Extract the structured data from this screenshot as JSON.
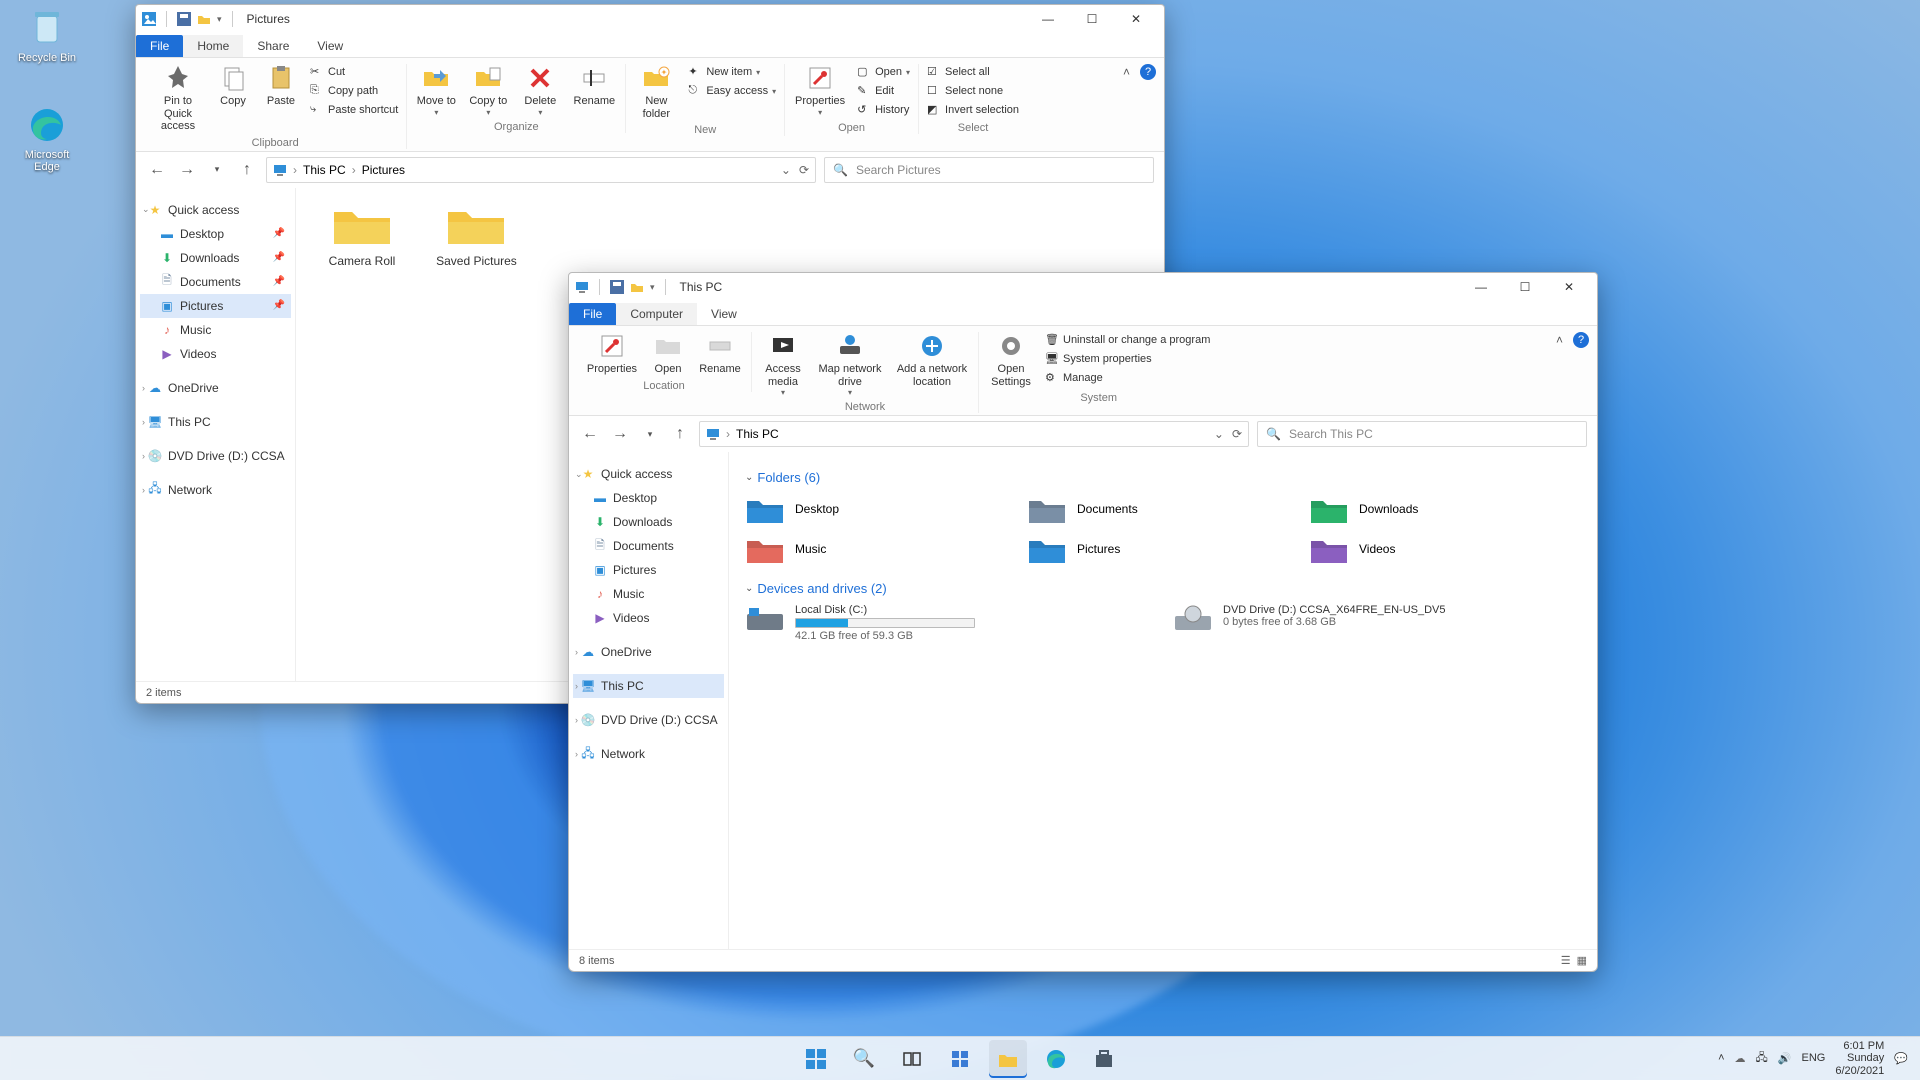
{
  "desktop": {
    "icons": [
      {
        "name": "Recycle Bin"
      },
      {
        "name": "Microsoft Edge"
      }
    ]
  },
  "win1": {
    "title": "Pictures",
    "tabs": {
      "file": "File",
      "home": "Home",
      "share": "Share",
      "view": "View"
    },
    "ribbon": {
      "clipboard": {
        "cap": "Clipboard",
        "pin": "Pin to Quick access",
        "copy": "Copy",
        "paste": "Paste",
        "cut": "Cut",
        "copypath": "Copy path",
        "pasteshort": "Paste shortcut"
      },
      "organize": {
        "cap": "Organize",
        "move": "Move to",
        "copyto": "Copy to",
        "delete": "Delete",
        "rename": "Rename"
      },
      "new": {
        "cap": "New",
        "newfolder": "New folder",
        "newitem": "New item",
        "easyaccess": "Easy access"
      },
      "open": {
        "cap": "Open",
        "properties": "Properties",
        "open": "Open",
        "edit": "Edit",
        "history": "History"
      },
      "select": {
        "cap": "Select",
        "all": "Select all",
        "none": "Select none",
        "invert": "Invert selection"
      }
    },
    "breadcrumb": {
      "pc": "This PC",
      "pictures": "Pictures"
    },
    "search_placeholder": "Search Pictures",
    "nav": {
      "quick": "Quick access",
      "desktop": "Desktop",
      "downloads": "Downloads",
      "documents": "Documents",
      "pictures": "Pictures",
      "music": "Music",
      "videos": "Videos",
      "onedrive": "OneDrive",
      "thispc": "This PC",
      "dvd": "DVD Drive (D:) CCSA",
      "network": "Network"
    },
    "items": [
      {
        "label": "Camera Roll"
      },
      {
        "label": "Saved Pictures"
      }
    ],
    "status": "2 items"
  },
  "win2": {
    "title": "This PC",
    "tabs": {
      "file": "File",
      "computer": "Computer",
      "view": "View"
    },
    "ribbon": {
      "location": {
        "cap": "Location",
        "properties": "Properties",
        "open": "Open",
        "rename": "Rename"
      },
      "network": {
        "cap": "Network",
        "access": "Access media",
        "map": "Map network drive",
        "add": "Add a network location"
      },
      "system": {
        "cap": "System",
        "settings": "Open Settings",
        "uninstall": "Uninstall or change a program",
        "sysprops": "System properties",
        "manage": "Manage"
      }
    },
    "breadcrumb": {
      "pc": "This PC"
    },
    "search_placeholder": "Search This PC",
    "nav": {
      "quick": "Quick access",
      "desktop": "Desktop",
      "downloads": "Downloads",
      "documents": "Documents",
      "pictures": "Pictures",
      "music": "Music",
      "videos": "Videos",
      "onedrive": "OneDrive",
      "thispc": "This PC",
      "dvd": "DVD Drive (D:) CCSA",
      "network": "Network"
    },
    "sections": {
      "folders": "Folders (6)",
      "drives": "Devices and drives (2)"
    },
    "folders": [
      {
        "label": "Desktop",
        "color": "#2f8ed8"
      },
      {
        "label": "Documents",
        "color": "#7a8fa6"
      },
      {
        "label": "Downloads",
        "color": "#2bb36b"
      },
      {
        "label": "Music",
        "color": "#e46a5e"
      },
      {
        "label": "Pictures",
        "color": "#2f8ed8"
      },
      {
        "label": "Videos",
        "color": "#8b5fc0"
      }
    ],
    "drives": [
      {
        "label": "Local Disk (C:)",
        "sub": "42.1 GB free of 59.3 GB",
        "fill_pct": 29
      },
      {
        "label": "DVD Drive (D:) CCSA_X64FRE_EN-US_DV5",
        "sub": "0 bytes free of 3.68 GB",
        "fill_pct": 0
      }
    ],
    "status": "8 items"
  },
  "taskbar": {
    "lang": "ENG",
    "time": "6:01 PM",
    "day": "Sunday",
    "date": "6/20/2021"
  }
}
